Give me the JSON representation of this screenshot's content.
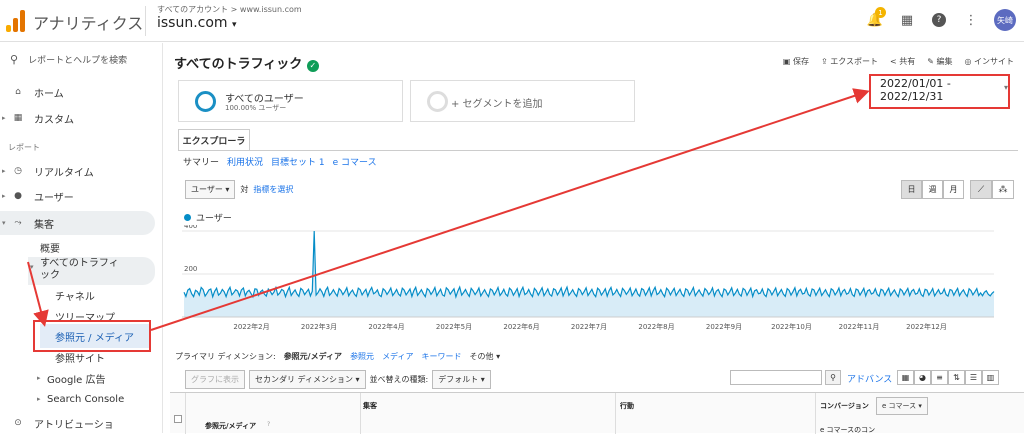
{
  "header": {
    "app_name": "アナリティクス",
    "breadcrumb": "すべてのアカウント > www.issun.com",
    "property": "issun.com",
    "notif_count": "1",
    "avatar_text": "矢崎"
  },
  "sidebar": {
    "search": "レポートとヘルプを検索",
    "items": [
      {
        "label": "ホーム"
      },
      {
        "label": "カスタム"
      },
      {
        "label": "レポート"
      },
      {
        "label": "リアルタイム"
      },
      {
        "label": "ユーザー"
      },
      {
        "label": "集客"
      },
      {
        "label": "概要"
      },
      {
        "label": "すべてのトラフィ"
      },
      {
        "label": "ック"
      },
      {
        "label": "チャネル"
      },
      {
        "label": "ツリーマップ"
      },
      {
        "label": "参照元 / メディア"
      },
      {
        "label": "参照サイト"
      },
      {
        "label": "Google 広告"
      },
      {
        "label": "Search Console"
      },
      {
        "label": "アトリビューショ"
      }
    ]
  },
  "page": {
    "title": "すべてのトラフィック",
    "actions": [
      "保存",
      "エクスポート",
      "共有",
      "編集",
      "インサイト"
    ],
    "segment": {
      "name": "すべてのユーザー",
      "pct": "100.00% ユーザー"
    },
    "add_segment": "+ セグメントを追加",
    "date_range": "2022/01/01 - 2022/12/31",
    "tab": "エクスプローラ",
    "subtabs": [
      "サマリー",
      "利用状況",
      "目標セット 1",
      "e コマース"
    ],
    "metric": "ユーザー",
    "versus": "対",
    "choose_metric": "指標を選択",
    "gran": [
      "日",
      "週",
      "月"
    ],
    "legend": "ユーザー",
    "primary_label": "プライマリ ディメンション:",
    "primary_dims": [
      "参照元/メディア",
      "参照元",
      "メディア",
      "キーワード",
      "その他"
    ],
    "graph_btn": "グラフに表示",
    "secondary": "セカンダリ ディメンション",
    "sort_label": "並べ替えの種類:",
    "sort_value": "デフォルト",
    "advanced": "アドバンス",
    "table": {
      "col1": "参照元/メディア",
      "acq": "集客",
      "behavior": "行動",
      "conv": "コンバージョン",
      "conv_select": "e コマース",
      "ecom_rate": "e コマースのコン"
    }
  },
  "chart_data": {
    "type": "line",
    "title": "",
    "xlabel": "",
    "ylabel": "",
    "ylim": [
      0,
      400
    ],
    "yticks": [
      200,
      400
    ],
    "months": [
      "2022年2月",
      "2022年3月",
      "2022年4月",
      "2022年5月",
      "2022年6月",
      "2022年7月",
      "2022年8月",
      "2022年9月",
      "2022年10月",
      "2022年11月",
      "2022年12月"
    ],
    "series": [
      {
        "name": "ユーザー",
        "values": [
          115,
          96,
          125,
          132,
          108,
          95,
          124,
          118,
          102,
          137,
          128,
          97,
          110,
          126,
          130,
          94,
          119,
          134,
          102,
          110,
          128,
          117,
          95,
          122,
          138,
          103,
          113,
          127,
          121,
          98,
          126,
          135,
          99,
          117,
          124,
          109,
          94,
          131,
          129,
          101,
          118,
          125,
          106,
          97,
          130,
          120,
          104,
          116,
          137,
          102,
          111,
          128,
          123,
          95,
          119,
          138,
          100,
          114,
          126,
          107,
          96,
          133,
          125,
          104,
          117,
          129,
          98,
          120,
          400,
          102,
          113,
          131,
          117,
          96,
          124,
          138,
          101,
          111,
          127,
          110,
          97,
          132,
          123,
          104,
          118,
          136,
          99,
          115,
          125,
          106,
          96,
          134,
          127,
          103,
          117,
          129,
          97,
          121,
          137,
          108,
          114,
          126,
          102,
          95,
          131,
          123,
          105,
          118,
          135,
          100,
          112,
          128,
          107,
          98,
          134,
          125,
          103,
          116,
          130,
          96,
          122,
          138,
          101,
          113,
          127,
          108,
          95,
          132,
          124,
          105,
          118,
          137,
          99,
          115,
          129,
          103,
          97,
          136,
          126,
          106,
          119,
          131,
          94,
          120,
          139,
          102,
          114,
          128,
          109,
          96,
          133,
          122,
          104,
          117,
          135,
          98,
          113,
          127,
          108,
          95,
          130,
          124,
          103,
          118,
          137,
          100,
          112,
          129,
          106,
          97,
          134,
          125,
          101,
          116,
          132,
          96,
          121,
          138,
          104,
          111,
          128,
          107,
          95,
          133,
          123,
          102,
          119,
          136,
          99,
          114,
          130,
          105,
          97,
          131,
          126,
          103,
          117,
          135,
          98,
          120,
          139,
          101,
          113,
          127,
          108,
          96,
          132,
          124,
          104,
          118,
          136,
          100,
          115,
          129,
          106,
          95,
          134,
          125,
          102,
          116,
          131,
          97,
          122,
          137,
          103,
          112,
          128,
          109,
          96,
          133,
          123,
          105,
          118,
          135,
          99,
          113,
          130,
          107,
          97,
          132,
          126,
          101,
          117,
          136,
          98,
          121,
          138,
          104,
          111,
          127,
          108,
          95,
          134,
          124,
          103,
          119,
          133,
          100,
          115,
          129,
          106,
          96,
          131,
          125,
          102,
          118,
          137,
          99,
          113,
          126,
          109,
          97,
          132,
          123,
          104,
          116,
          135,
          98,
          120,
          128,
          107,
          95,
          130,
          124,
          103,
          117,
          136,
          100,
          112,
          129,
          106,
          97,
          133,
          125,
          101,
          118,
          134,
          96,
          122,
          127,
          108,
          111,
          130,
          104,
          95,
          131,
          123,
          103,
          119,
          135,
          99,
          114,
          128,
          106,
          96,
          132,
          124,
          102,
          117,
          136,
          98,
          121,
          129,
          107,
          110,
          133,
          105,
          97,
          130,
          126,
          101,
          118,
          134,
          100,
          113,
          127,
          108,
          95,
          131,
          124,
          103,
          116,
          135,
          99,
          120,
          128,
          106,
          111,
          132,
          104,
          96,
          130,
          125,
          102,
          117,
          133,
          98,
          122,
          127,
          107,
          112,
          131,
          105,
          97,
          129,
          124,
          101,
          119,
          134,
          100,
          114,
          126,
          108,
          95,
          130,
          123,
          103,
          118,
          133,
          99,
          121,
          128,
          106,
          110,
          131,
          104,
          96,
          129,
          125,
          102,
          116,
          132,
          98,
          113,
          127,
          107,
          111,
          130,
          104,
          97,
          128,
          124,
          101,
          118,
          133,
          99,
          115,
          126,
          108,
          96,
          131,
          123,
          103,
          117,
          132,
          100,
          112,
          99,
          115,
          122,
          105,
          98,
          110,
          118
        ]
      }
    ]
  }
}
